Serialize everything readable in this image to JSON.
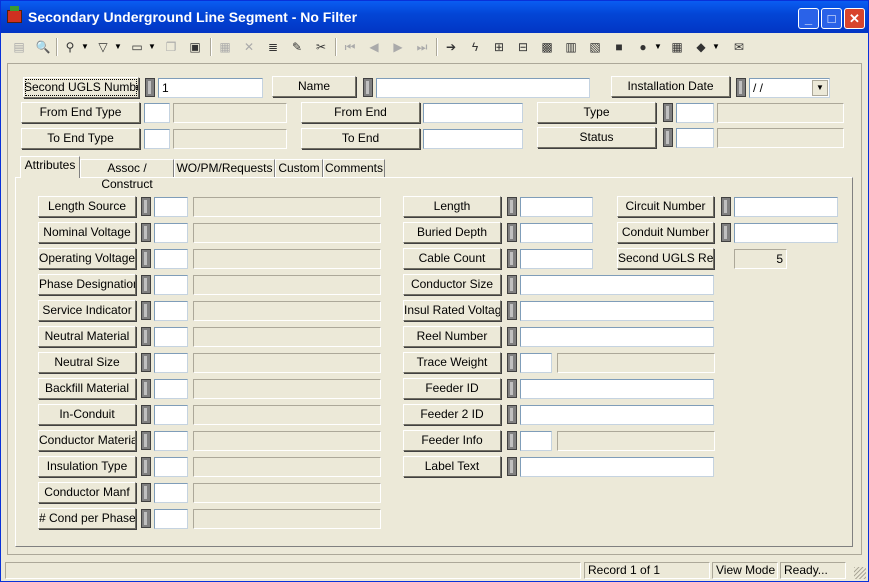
{
  "window": {
    "title": "Secondary Underground Line Segment - No Filter",
    "minimize": "_",
    "maximize": "□",
    "close": "✕"
  },
  "toolbar": {
    "icons": [
      "save-icon",
      "preview-icon",
      "binoculars-icon",
      "filter-icon",
      "new-record-icon",
      "copy-icon",
      "document-icon",
      "disk-icon",
      "delete-icon",
      "books-icon",
      "pencil-icon",
      "scissors-icon",
      "first-record-icon",
      "prev-record-icon",
      "next-record-icon",
      "last-record-icon",
      "arrow-right-icon",
      "lightning-icon",
      "network-icon",
      "tree-icon",
      "map-icon",
      "calculator-icon",
      "image-icon",
      "truck-icon",
      "globe-icon",
      "grid-icon",
      "book-icon",
      "export-icon"
    ]
  },
  "header": {
    "second_ugls_number_label": "Second UGLS Number",
    "second_ugls_number_value": "1",
    "name_label": "Name",
    "name_value": "",
    "installation_date_label": "Installation Date",
    "installation_date_value": " /  /",
    "from_end_type_label": "From End Type",
    "from_end_label": "From End",
    "type_label": "Type",
    "to_end_type_label": "To End Type",
    "to_end_label": "To End",
    "status_label": "Status"
  },
  "tabs": [
    {
      "label": "Attributes",
      "active": true
    },
    {
      "label": "Assoc / Construct",
      "active": false
    },
    {
      "label": "WO/PM/Requests",
      "active": false
    },
    {
      "label": "Custom",
      "active": false
    },
    {
      "label": "Comments",
      "active": false
    }
  ],
  "attributes": {
    "left_fields": [
      {
        "label": "Length Source",
        "value": ""
      },
      {
        "label": "Nominal Voltage",
        "value": ""
      },
      {
        "label": "Operating Voltage",
        "value": ""
      },
      {
        "label": "Phase Designation",
        "value": ""
      },
      {
        "label": "Service Indicator",
        "value": ""
      },
      {
        "label": "Neutral Material",
        "value": ""
      },
      {
        "label": "Neutral Size",
        "value": ""
      },
      {
        "label": "Backfill Material",
        "value": ""
      },
      {
        "label": "In-Conduit",
        "value": ""
      },
      {
        "label": "Conductor Material",
        "value": ""
      },
      {
        "label": "Insulation Type",
        "value": ""
      },
      {
        "label": "Conductor Manf",
        "value": ""
      },
      {
        "label": "# Cond per Phase",
        "value": ""
      }
    ],
    "mid_fields": [
      {
        "label": "Length",
        "value": ""
      },
      {
        "label": "Buried Depth",
        "value": ""
      },
      {
        "label": "Cable Count",
        "value": ""
      },
      {
        "label": "Conductor Size",
        "value": ""
      },
      {
        "label": "Insul Rated Voltage",
        "value": ""
      },
      {
        "label": "Reel Number",
        "value": ""
      },
      {
        "label": "Trace Weight",
        "value": ""
      },
      {
        "label": "Feeder ID",
        "value": ""
      },
      {
        "label": "Feeder 2 ID",
        "value": ""
      },
      {
        "label": "Feeder Info",
        "value": ""
      },
      {
        "label": "Label Text",
        "value": ""
      }
    ],
    "circuit_number_label": "Circuit Number",
    "conduit_number_label": "Conduit Number",
    "second_ugls_rec_label": "Second UGLS Rec #",
    "second_ugls_rec_value": "5"
  },
  "status": {
    "record": "Record 1 of 1",
    "mode": "View Mode",
    "state": "Ready..."
  }
}
